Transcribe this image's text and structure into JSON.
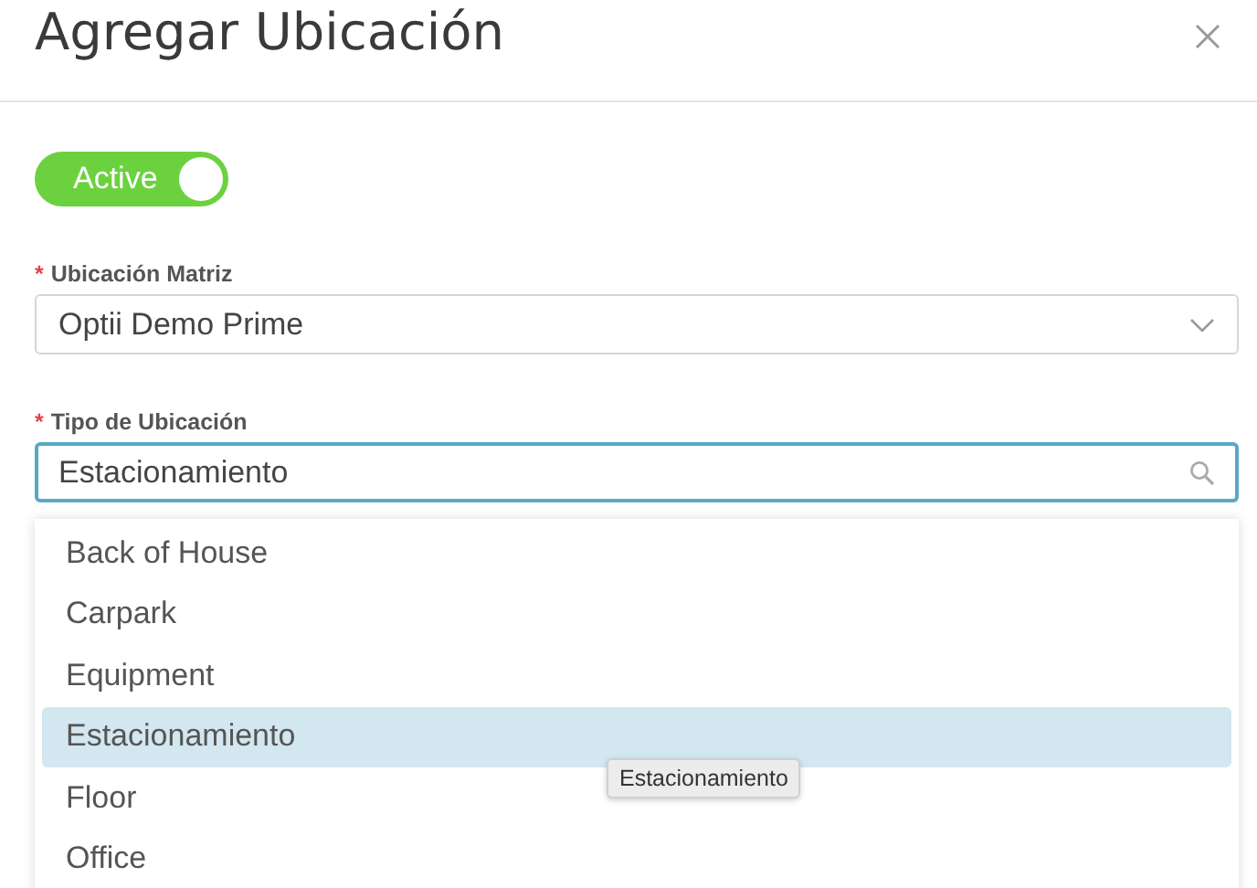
{
  "dialog": {
    "title": "Agregar Ubicación"
  },
  "active_toggle": {
    "label": "Active",
    "on": true
  },
  "fields": [
    {
      "kind": "select",
      "required_mark": "*",
      "label": "Ubicación Matriz",
      "value": "Optii Demo Prime",
      "focused": false
    },
    {
      "kind": "search",
      "required_mark": "*",
      "label": "Tipo de Ubicación",
      "value": "Estacionamiento",
      "focused": true
    }
  ],
  "dropdown": {
    "options": [
      {
        "label": "Back of House",
        "selected": false
      },
      {
        "label": "Carpark",
        "selected": false
      },
      {
        "label": "Equipment",
        "selected": false
      },
      {
        "label": "Estacionamiento",
        "selected": true
      },
      {
        "label": "Floor",
        "selected": false
      },
      {
        "label": "Office",
        "selected": false
      }
    ]
  },
  "tooltip": {
    "text": "Estacionamiento"
  }
}
